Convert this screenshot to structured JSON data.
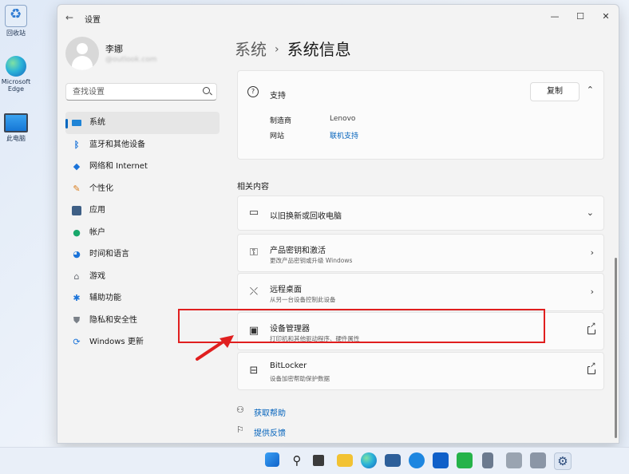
{
  "desktop": {
    "icons": [
      {
        "label": "回收站"
      },
      {
        "label": "Microsoft Edge"
      },
      {
        "label": "此电脑"
      }
    ]
  },
  "window": {
    "app_title": "设置",
    "controls": {
      "minimize": "—",
      "maximize": "☐",
      "close": "✕"
    }
  },
  "profile": {
    "name": "李娜",
    "email": "@outlook.com"
  },
  "search": {
    "placeholder": "查找设置"
  },
  "sidebar": {
    "items": [
      {
        "label": "系统",
        "active": true
      },
      {
        "label": "蓝牙和其他设备"
      },
      {
        "label": "网络和 Internet"
      },
      {
        "label": "个性化"
      },
      {
        "label": "应用"
      },
      {
        "label": "帐户"
      },
      {
        "label": "时间和语言"
      },
      {
        "label": "游戏"
      },
      {
        "label": "辅助功能"
      },
      {
        "label": "隐私和安全性"
      },
      {
        "label": "Windows 更新"
      }
    ]
  },
  "breadcrumb": {
    "parent": "系统",
    "separator": "›",
    "current": "系统信息"
  },
  "support": {
    "title": "支持",
    "copy_label": "复制",
    "rows": [
      {
        "key": "制造商",
        "value": "Lenovo"
      },
      {
        "key": "网站",
        "value": "联机支持"
      }
    ]
  },
  "related": {
    "heading": "相关内容",
    "cards": [
      {
        "title": "以旧换新或回收电脑",
        "subtitle": ""
      },
      {
        "title": "产品密钥和激活",
        "subtitle": "更改产品密钥或升级 Windows"
      },
      {
        "title": "远程桌面",
        "subtitle": "从另一台设备控制此设备"
      },
      {
        "title": "设备管理器",
        "subtitle": "打印机和其他驱动程序、硬件属性"
      },
      {
        "title": "BitLocker",
        "subtitle": "设备加密帮助保护数据"
      }
    ]
  },
  "help": {
    "get_help": "获取帮助",
    "feedback": "提供反馈"
  },
  "colors": {
    "accent": "#0067c0",
    "highlight": "#e01f1f"
  }
}
